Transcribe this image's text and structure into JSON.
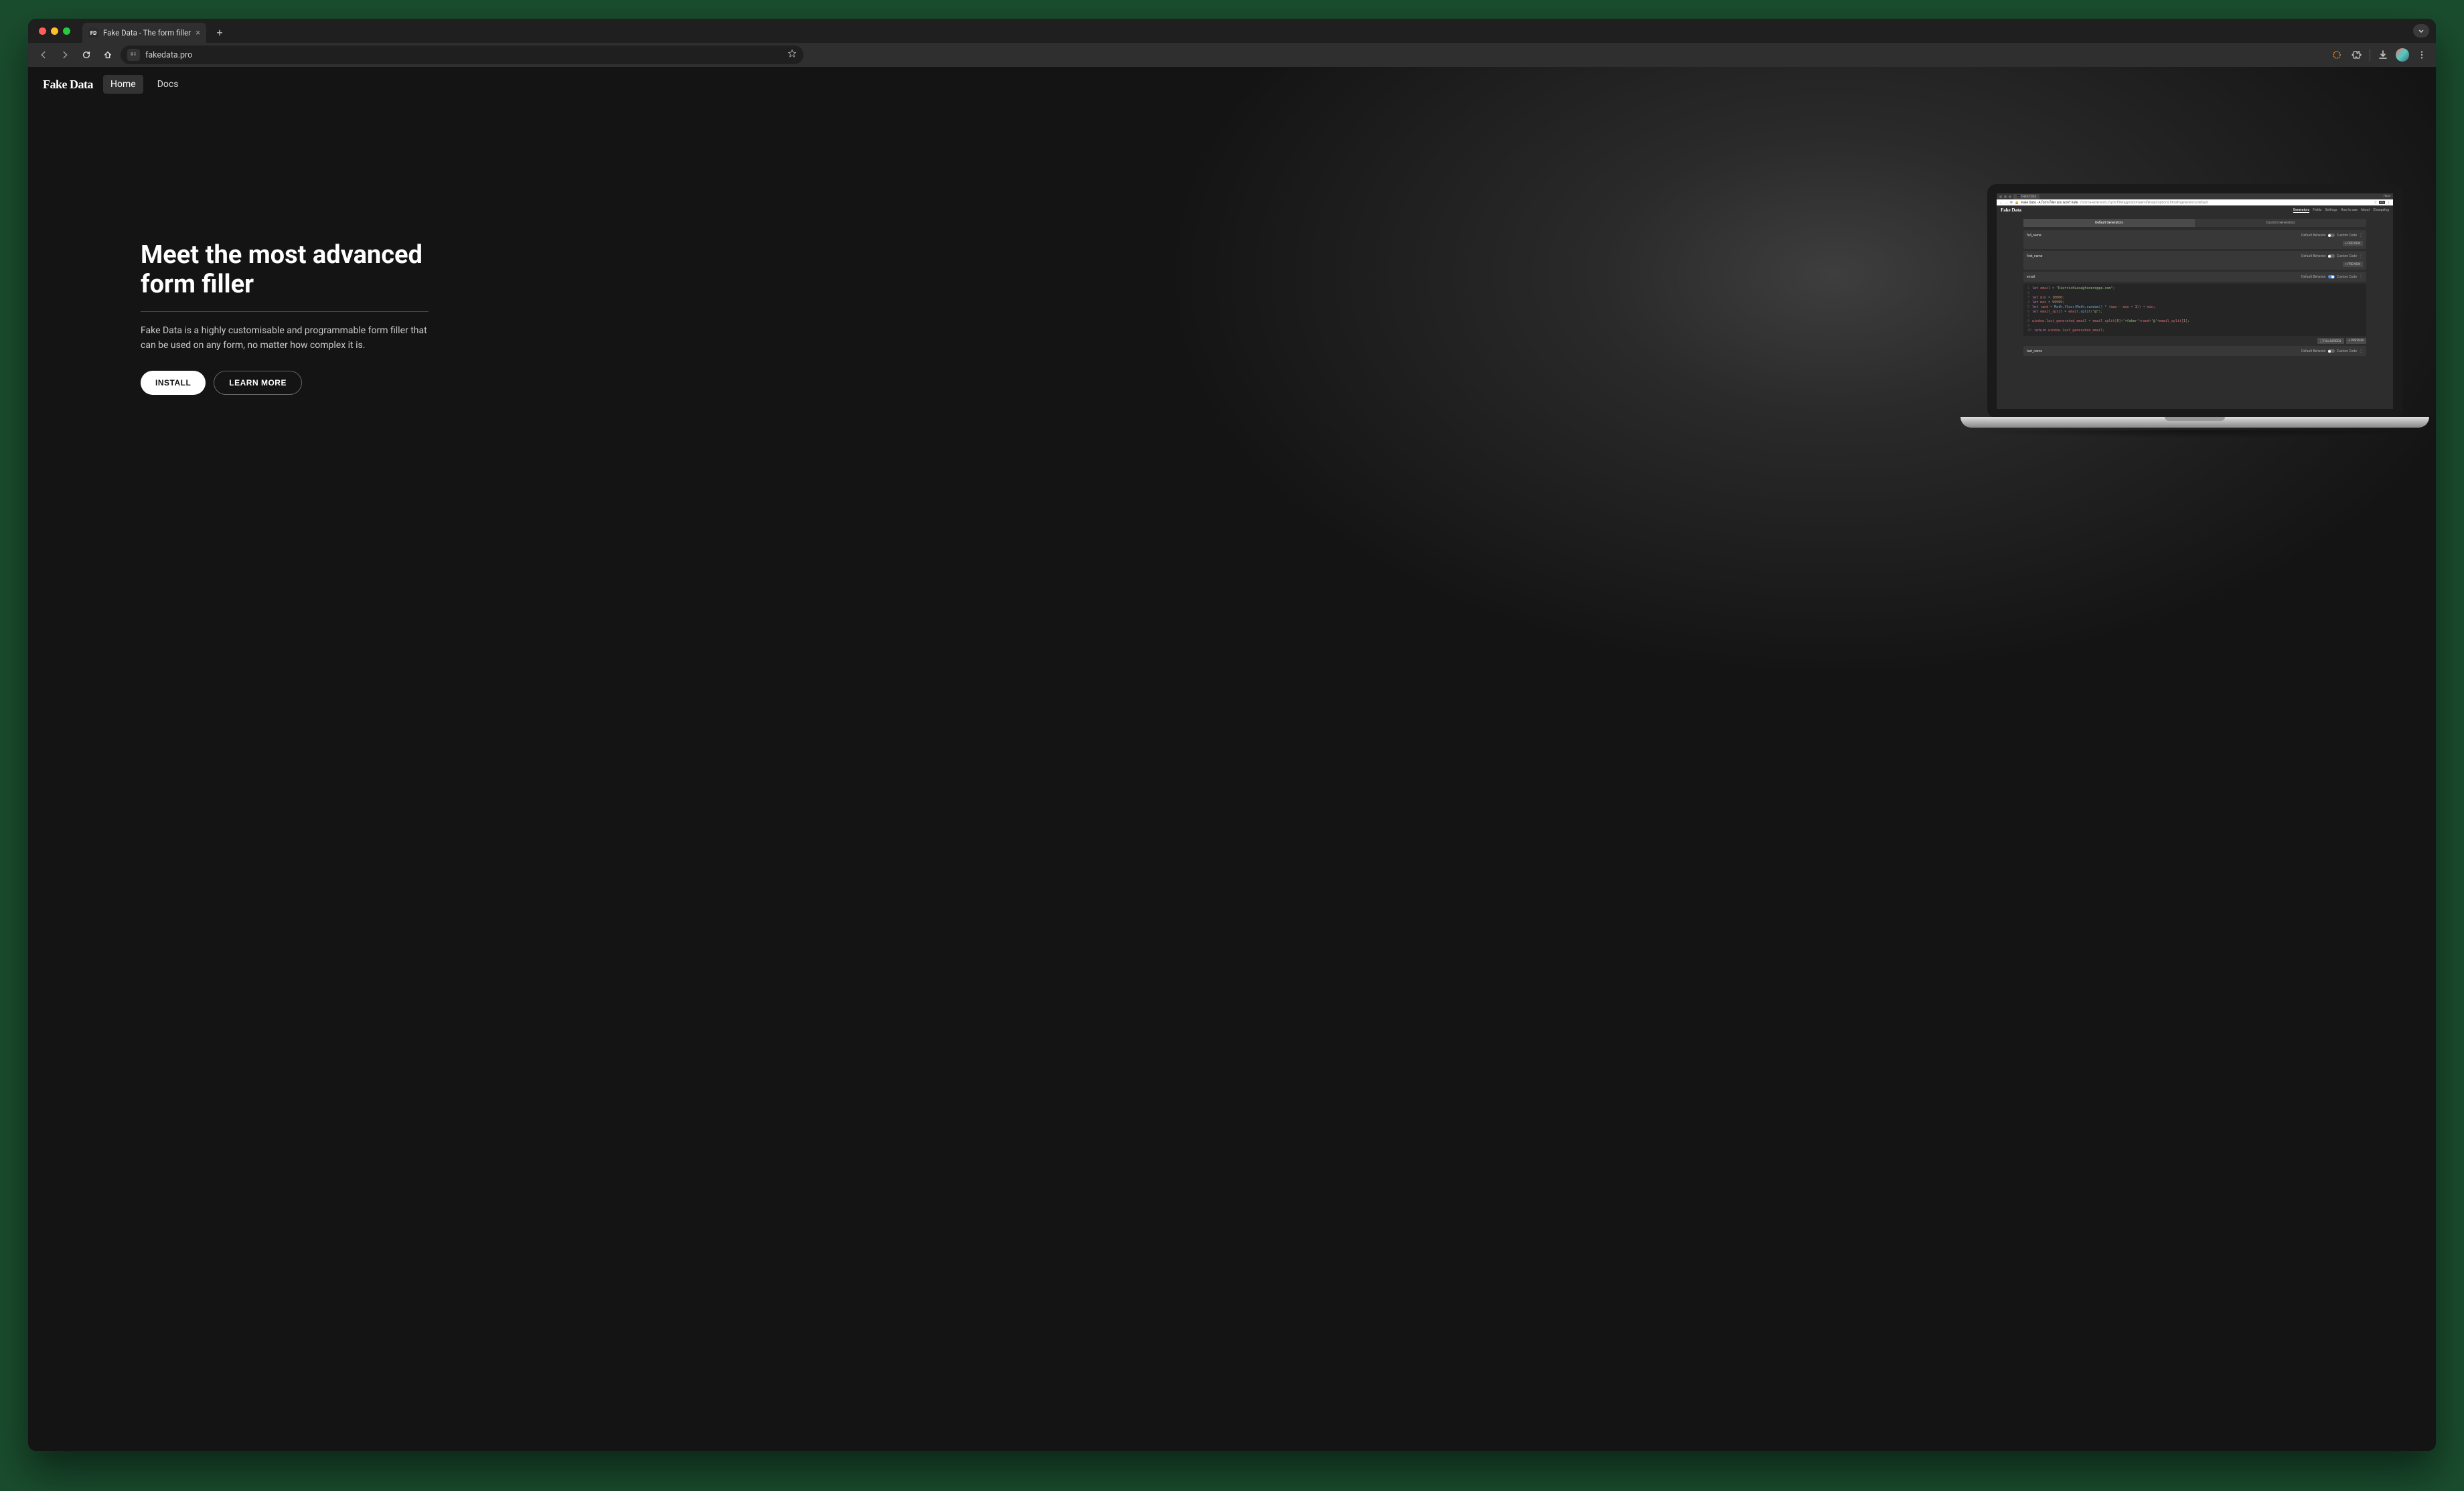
{
  "browser": {
    "tab": {
      "favicon": "FD",
      "title": "Fake Data - The form filler"
    },
    "url": "fakedata.pro"
  },
  "nav": {
    "logo": "Fake Data",
    "links": {
      "home": "Home",
      "docs": "Docs"
    }
  },
  "hero": {
    "title": "Meet the most advanced form filler",
    "description": "Fake Data is a highly customisable and programmable form filler that can be used on any form, no matter how complex it is.",
    "install": "INSTALL",
    "learn_more": "LEARN MORE"
  },
  "laptop": {
    "tab": {
      "favicon": "FD",
      "title": "Fake Data"
    },
    "meta_right": "Haze",
    "url_left": "Fake Data - A form filler you won't hate",
    "url": "chrome-extension://gchcfdbkajglnobohlaemifehasjl/options.html#/generators/default",
    "url_badge": "FD",
    "app_nav": {
      "logo": "Fake Data",
      "links": [
        "Generators",
        "Fields",
        "Settings",
        "How to use",
        "About",
        "Changelog"
      ]
    },
    "tabs": {
      "default": "Default Generators",
      "custom": "Custom Generators"
    },
    "labels": {
      "default_behavior": "Default Behavior",
      "custom_code": "Custom Code",
      "preview": "+ PREVIEW",
      "fullscreen": "⛶ FULLSCREEN"
    },
    "generators": [
      {
        "name": "full_name",
        "custom": false
      },
      {
        "name": "first_name",
        "custom": false
      },
      {
        "name": "email",
        "custom": true
      },
      {
        "name": "last_name",
        "custom": false
      }
    ],
    "code": [
      {
        "ln": 1,
        "parts": [
          [
            "kw",
            "let"
          ],
          [
            "op",
            " "
          ],
          [
            "varn",
            "email"
          ],
          [
            "op",
            " = "
          ],
          [
            "str",
            "\"DietrichLesa@fanereppe.com\""
          ],
          [
            "op",
            ";"
          ]
        ]
      },
      {
        "ln": 2,
        "parts": []
      },
      {
        "ln": 3,
        "parts": [
          [
            "kw",
            "let"
          ],
          [
            "op",
            " "
          ],
          [
            "varn",
            "min"
          ],
          [
            "op",
            " = "
          ],
          [
            "num",
            "10000"
          ],
          [
            "op",
            ";"
          ]
        ]
      },
      {
        "ln": 4,
        "parts": [
          [
            "kw",
            "let"
          ],
          [
            "op",
            " "
          ],
          [
            "varn",
            "max"
          ],
          [
            "op",
            " = "
          ],
          [
            "num",
            "99999"
          ],
          [
            "op",
            ";"
          ]
        ]
      },
      {
        "ln": 5,
        "parts": [
          [
            "kw",
            "let"
          ],
          [
            "op",
            " "
          ],
          [
            "varn",
            "rand"
          ],
          [
            "op",
            " = "
          ],
          [
            "fn",
            "Math.floor"
          ],
          [
            "op",
            "("
          ],
          [
            "fn",
            "Math.random"
          ],
          [
            "op",
            "() * ("
          ],
          [
            "varn",
            "max"
          ],
          [
            "op",
            " - "
          ],
          [
            "varn",
            "min"
          ],
          [
            "op",
            " + "
          ],
          [
            "num",
            "1"
          ],
          [
            "op",
            ")) + "
          ],
          [
            "varn",
            "min"
          ],
          [
            "op",
            ";"
          ]
        ]
      },
      {
        "ln": 6,
        "parts": [
          [
            "kw",
            "let"
          ],
          [
            "op",
            " "
          ],
          [
            "varn",
            "email_split"
          ],
          [
            "op",
            " = "
          ],
          [
            "varn",
            "email"
          ],
          [
            "op",
            "."
          ],
          [
            "fn",
            "split"
          ],
          [
            "op",
            "("
          ],
          [
            "str",
            "\"@\""
          ],
          [
            "op",
            ");"
          ]
        ]
      },
      {
        "ln": 7,
        "parts": []
      },
      {
        "ln": 8,
        "parts": [
          [
            "varn",
            "window"
          ],
          [
            "op",
            "."
          ],
          [
            "varn",
            "last_generated_email"
          ],
          [
            "op",
            " = "
          ],
          [
            "varn",
            "email_split"
          ],
          [
            "op",
            "["
          ],
          [
            "num",
            "0"
          ],
          [
            "op",
            "]+"
          ],
          [
            "str",
            "'+faker'"
          ],
          [
            "op",
            "+"
          ],
          [
            "varn",
            "rand"
          ],
          [
            "op",
            "+"
          ],
          [
            "str",
            "'@'"
          ],
          [
            "op",
            "+"
          ],
          [
            "varn",
            "email_split"
          ],
          [
            "op",
            "["
          ],
          [
            "num",
            "1"
          ],
          [
            "op",
            "];"
          ]
        ]
      },
      {
        "ln": 9,
        "parts": []
      },
      {
        "ln": 10,
        "parts": [
          [
            "kw",
            "return"
          ],
          [
            "op",
            " "
          ],
          [
            "varn",
            "window"
          ],
          [
            "op",
            "."
          ],
          [
            "varn",
            "last_generated_email"
          ],
          [
            "op",
            ";"
          ]
        ]
      }
    ]
  }
}
